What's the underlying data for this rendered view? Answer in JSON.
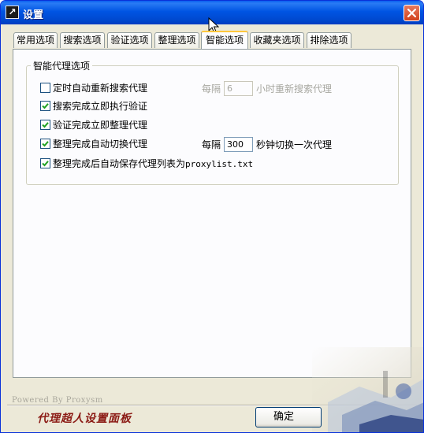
{
  "window": {
    "title": "设置"
  },
  "tabs": [
    {
      "label": "常用选项",
      "active": false
    },
    {
      "label": "搜索选项",
      "active": false
    },
    {
      "label": "验证选项",
      "active": false
    },
    {
      "label": "整理选项",
      "active": false
    },
    {
      "label": "智能选项",
      "active": true
    },
    {
      "label": "收藏夹选项",
      "active": false
    },
    {
      "label": "排除选项",
      "active": false
    }
  ],
  "group": {
    "title": "智能代理选项"
  },
  "options": [
    {
      "label": "定时自动重新搜索代理",
      "checked": false
    },
    {
      "label": "搜索完成立即执行验证",
      "checked": true
    },
    {
      "label": "验证完成立即整理代理",
      "checked": true
    },
    {
      "label": "整理完成自动切换代理",
      "checked": true
    },
    {
      "label": "整理完成后自动保存代理列表为",
      "suffix": "proxylist.txt",
      "checked": true
    }
  ],
  "research_interval": {
    "prefix": "每隔",
    "value": "6",
    "suffix": "小时重新搜索代理",
    "enabled": false
  },
  "switch_interval": {
    "prefix": "每隔",
    "value": "300",
    "suffix": "秒钟切换一次代理",
    "enabled": true
  },
  "footer": {
    "powered_by": "Powered By Proxysm",
    "brand": "代理超人设置面板",
    "ok_label": "确定"
  },
  "colors": {
    "titlebar": "#0054e3",
    "window_bg": "#ece9d8",
    "brand_text": "#8b1a14",
    "tab_highlight": "#ffc73c"
  }
}
